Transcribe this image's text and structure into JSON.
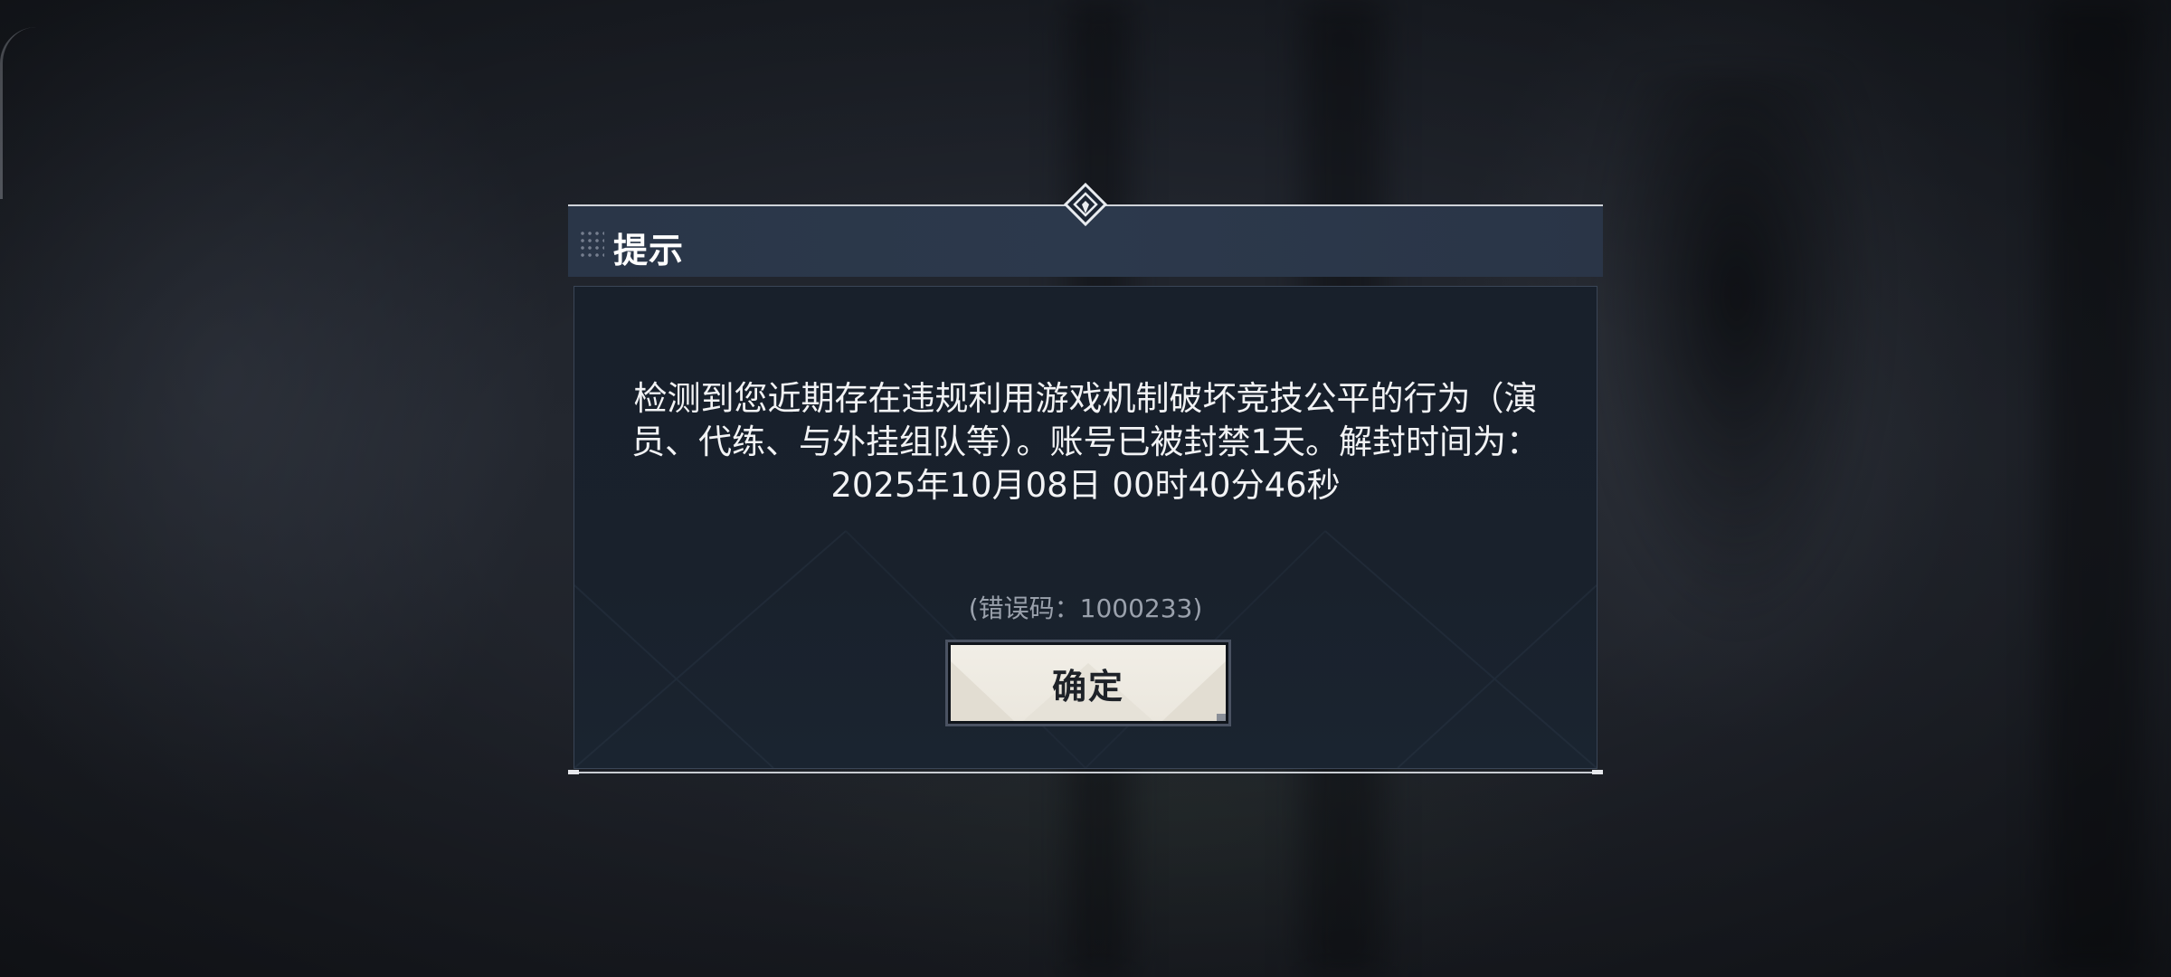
{
  "dialog": {
    "title": "提示",
    "message": "检测到您近期存在违规利用游戏机制破坏竞技公平的行为（演员、代练、与外挂组队等）。账号已被封禁1天。解封时间为：2025年10月08日 00时40分46秒",
    "error_code": "(错误码：1000233)",
    "confirm_label": "确定"
  },
  "icons": {
    "header_grip": "drag-handle-icon",
    "header_emblem": "diamond-emblem-icon"
  },
  "colors": {
    "header_bg": "#2a3648",
    "panel_bg": "#18202b",
    "button_bg": "#efece4",
    "button_text": "#1e2228",
    "error_code_text": "#9aa1ac"
  }
}
